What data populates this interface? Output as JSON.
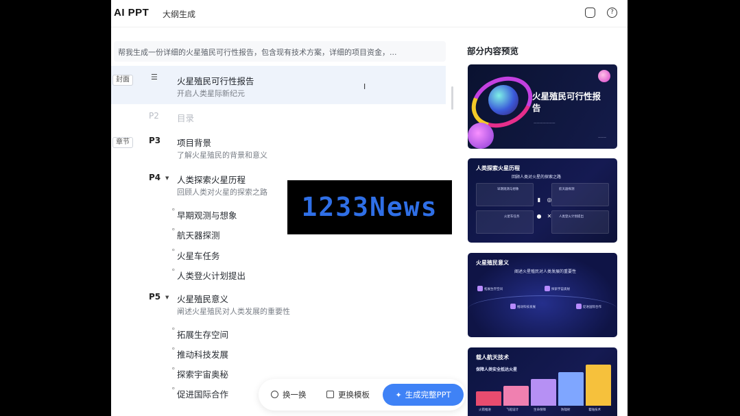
{
  "topbar": {
    "brand": "AI PPT",
    "section": "大纲生成",
    "icons": [
      "bag-icon",
      "help-icon"
    ]
  },
  "outline": {
    "prompt": "帮我生成一份详细的火星殖民可行性报告，包含现有技术方案，详细的项目资金，...",
    "slides": [
      {
        "tag": "封面",
        "num": "",
        "title": "火星殖民可行性报告",
        "subtitle": "开启人类星际新纪元"
      },
      {
        "tag": "",
        "num": "P2",
        "title": "目录",
        "subtitle": ""
      },
      {
        "tag": "章节",
        "num": "P3",
        "title": "项目背景",
        "subtitle": "了解火星殖民的背景和意义"
      },
      {
        "tag": "",
        "num": "P4",
        "title": "人类探索火星历程",
        "subtitle": "回顾人类对火星的探索之路",
        "bullets": [
          "早期观测与想象",
          "航天器探测",
          "火星车任务",
          "人类登火计划提出"
        ]
      },
      {
        "tag": "",
        "num": "P5",
        "title": "火星殖民意义",
        "subtitle": "阐述火星殖民对人类发展的重要性",
        "bullets": [
          "拓展生存空间",
          "推动科技发展",
          "探索宇宙奥秘",
          "促进国际合作"
        ]
      }
    ]
  },
  "actions": {
    "shuffle": "换一换",
    "template": "更换模板",
    "generate": "生成完整PPT"
  },
  "preview": {
    "title": "部分内容预览",
    "card1": {
      "title": "火星殖民可行性报告"
    },
    "card2": {
      "title": "人类探索火星历程",
      "subtitle": "回顾人类对火星的探索之路",
      "boxes": [
        "早期观测与想象",
        "航天器探测",
        "火星车任务",
        "人类登火计划提出"
      ]
    },
    "card3": {
      "title": "火星殖民意义",
      "subtitle": "阐述火星殖民对人类发展的重要性",
      "items": [
        "拓展生存空间",
        "推动科技发展",
        "探索宇宙奥秘",
        "促进国际合作"
      ]
    },
    "card4": {
      "title": "载人航天技术",
      "subtitle": "保障人类安全抵达火星",
      "labels": [
        "火箭推进",
        "飞船设计",
        "生命保障",
        "防辐射",
        "着陆技术"
      ],
      "bar_colors": [
        "#e84c6f",
        "#f080b0",
        "#b690f4",
        "#7fa6ff",
        "#f6c13c"
      ],
      "bar_levels": [
        0.3,
        0.42,
        0.55,
        0.7,
        0.85
      ]
    }
  },
  "watermark": "1233News"
}
